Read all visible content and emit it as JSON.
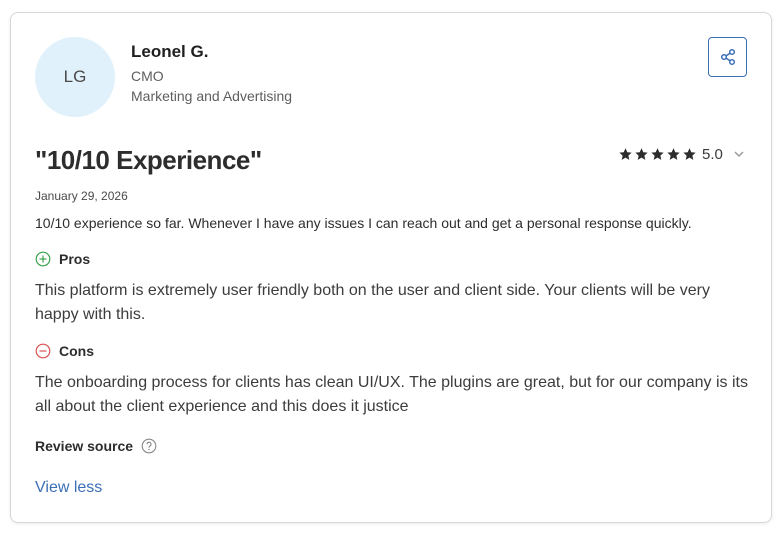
{
  "reviewer": {
    "initials": "LG",
    "name": "Leonel G.",
    "role": "CMO",
    "industry": "Marketing and Advertising"
  },
  "review": {
    "title": "\"10/10 Experience\"",
    "rating": 5,
    "rating_label": "5.0",
    "date": "January 29, 2026",
    "summary": "10/10 experience so far. Whenever I have any issues I can reach out and get a personal response quickly.",
    "pros_label": "Pros",
    "pros_text": "This platform is extremely user friendly both on the user and client side. Your clients will be very happy with this.",
    "cons_label": "Cons",
    "cons_text": "The onboarding process for clients has clean UI/UX. The plugins are great, but for our company is its all about the client experience and this does it justice",
    "source_label": "Review source"
  },
  "actions": {
    "view_less": "View less"
  },
  "icons": {
    "share": "share-icon",
    "star": "star-icon",
    "chevron": "chevron-down-icon",
    "pros": "plus-circle-icon",
    "cons": "minus-circle-icon",
    "help": "question-circle-icon"
  },
  "colors": {
    "accent": "#3b6fb6",
    "pros": "#3aa34a",
    "cons": "#d9534f",
    "avatar_bg": "#e1f1fb",
    "star": "#2d2d2d"
  }
}
